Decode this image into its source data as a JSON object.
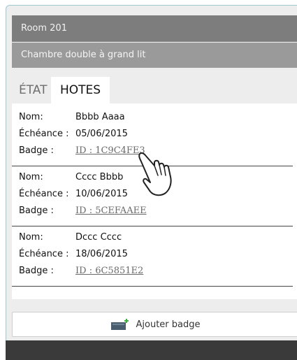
{
  "room": {
    "title": "Room 201",
    "type": "Chambre double à grand lit"
  },
  "tabs": [
    {
      "label": "ÉTAT",
      "active": false
    },
    {
      "label": "HOTES",
      "active": true
    }
  ],
  "labels": {
    "name": "Nom:",
    "expiry": "Échéance :",
    "badge": "Badge :"
  },
  "guests": [
    {
      "name": "Bbbb Aaaa",
      "expiry": "05/06/2015",
      "badge": "ID : 1C9C4FE3"
    },
    {
      "name": "Cccc Bbbb",
      "expiry": "10/06/2015",
      "badge": "ID : 5CEFAAEE"
    },
    {
      "name": "Dccc Cccc",
      "expiry": "18/06/2015",
      "badge": "ID : 6C5851E2"
    }
  ],
  "actions": {
    "add_badge": "Ajouter badge"
  },
  "colors": {
    "header_bg": "#7d7d7d",
    "subheader_bg": "#9a9a9a",
    "frame_bg": "#ededed",
    "footer_bg": "#3a3a3a",
    "frame_border": "#9ec7d2"
  },
  "icons": {
    "pointer": "hand-pointer-icon",
    "add_badge": "badge-card-add-icon"
  }
}
